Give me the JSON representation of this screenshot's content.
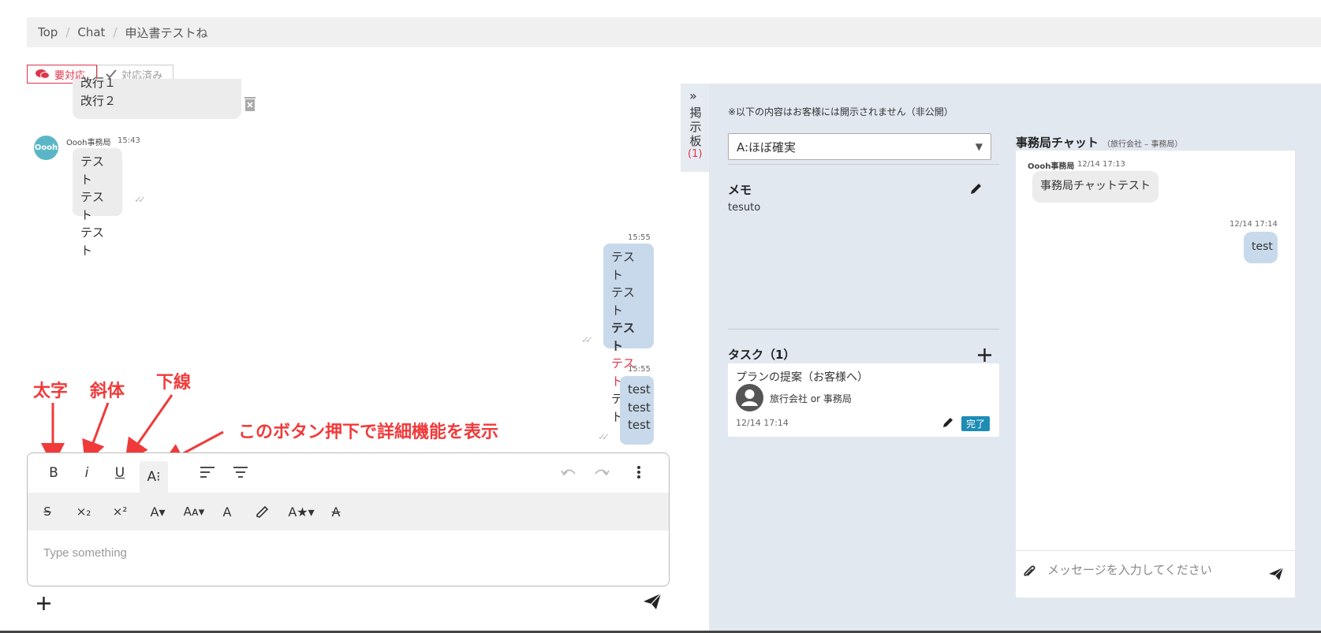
{
  "breadcrumb": {
    "top": "Top",
    "chat": "Chat",
    "current": "申込書テストね"
  },
  "status_buttons": {
    "needs_action": "要対応",
    "done": "対応済み"
  },
  "messages": {
    "partial_line1": "改行１",
    "partial_line2": "改行２",
    "avatar_text": "Oooh",
    "sender": "Oooh事務局",
    "sender_time": "15:43",
    "msg1": [
      "テスト",
      "テスト",
      "テスト"
    ],
    "mine1_time": "15:55",
    "mine1": [
      "テスト",
      "テスト",
      "テスト",
      "テスト",
      "テスト"
    ],
    "mine2_time": "15:55",
    "mine2": [
      "test",
      "test",
      "test"
    ]
  },
  "annotations": {
    "bold": "太字",
    "italic": "斜体",
    "underline": "下線",
    "more": "このボタン押下で詳細機能を表示"
  },
  "editor": {
    "placeholder": "Type something",
    "bold": "B",
    "italic": "i",
    "underline": "U",
    "font": "A⁝"
  },
  "board_tab": {
    "label1": "掲",
    "label2": "示",
    "label3": "板",
    "count": "(1)"
  },
  "board": {
    "notice": "※以下の内容はお客様には開示されません（非公開）",
    "status_value": "A:ほぼ確実",
    "memo_title": "メモ",
    "memo_text": "tesuto",
    "task_title": "タスク（1）",
    "task_name": "プランの提案（お客様へ）",
    "task_assignee": "旅行会社 or 事務局",
    "task_date": "12/14 17:14",
    "task_status": "完了"
  },
  "staff_chat": {
    "title": "事務局チャット",
    "subtitle": "（旅行会社 – 事務局）",
    "sender": "Oooh事務局",
    "msg1_time": "12/14 17:13",
    "msg1": "事務局チャットテスト",
    "msg2_time": "12/14 17:14",
    "msg2": "test",
    "input_placeholder": "メッセージを入力してください"
  },
  "colors": {
    "accent_red": "#f03a3a",
    "needs_action": "#e0334a",
    "done_badge": "#1f8cb6",
    "my_bubble": "#c8d9ec"
  }
}
